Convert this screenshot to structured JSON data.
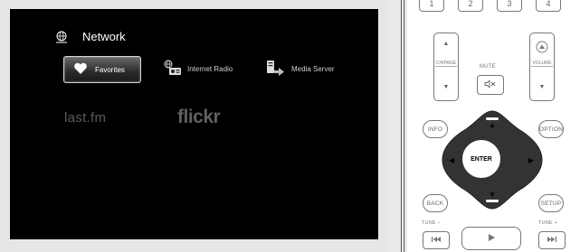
{
  "screen": {
    "header": {
      "title": "Network",
      "icon": "network-globe-icon"
    },
    "services": [
      {
        "label": "Favorites",
        "icon": "heart-icon",
        "selected": true
      },
      {
        "label": "Internet Radio",
        "icon": "internet-radio-icon",
        "selected": false
      },
      {
        "label": "Media Server",
        "icon": "media-server-icon",
        "selected": false
      }
    ],
    "extra_services": [
      {
        "label": "last.fm"
      },
      {
        "label": "flickr"
      }
    ]
  },
  "remote": {
    "number_keys": [
      "1",
      "2",
      "3",
      "4"
    ],
    "ch_page_label": "CH/PAGE",
    "mute_label": "MUTE",
    "mute_icon": "mute-icon",
    "volume_label": "VOLUME",
    "info_label": "INFO",
    "option_label": "OPTION",
    "enter_label": "ENTER",
    "back_label": "BACK",
    "setup_label": "SETUP",
    "tune_minus_label": "TUNE −",
    "tune_plus_label": "TUNE +",
    "colors": {
      "dpad": "#333333",
      "screen_bg": "#000000",
      "selected_border": "#d6d6d6"
    }
  }
}
